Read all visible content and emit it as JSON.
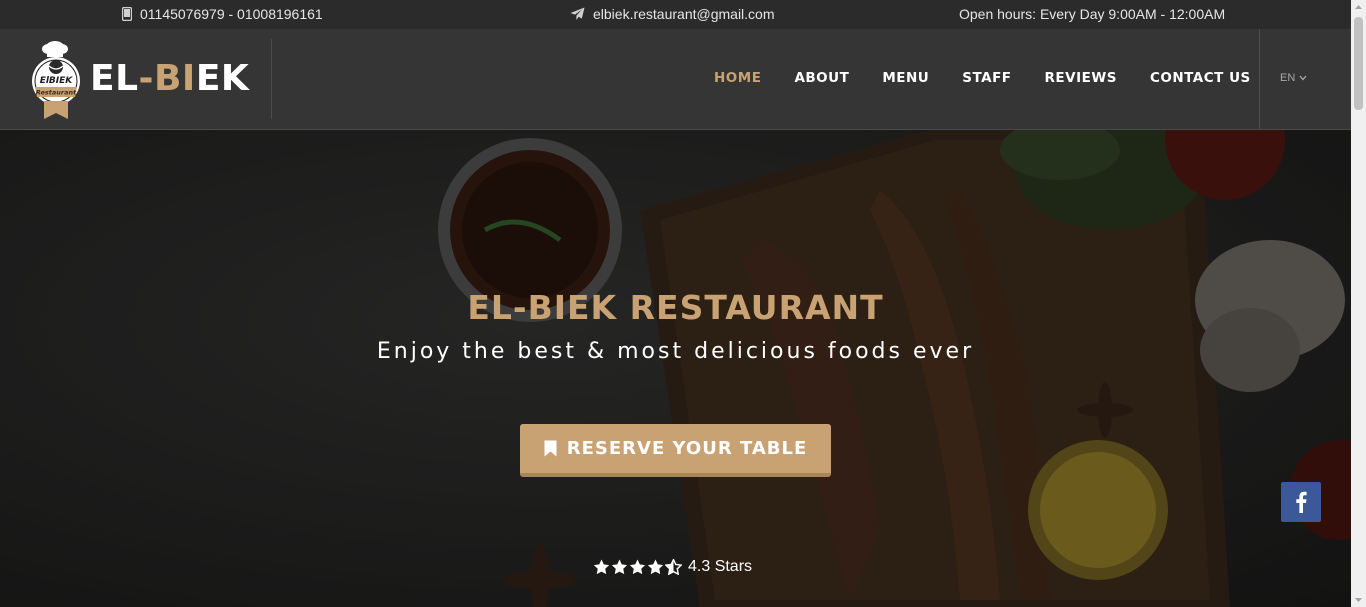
{
  "topbar": {
    "phone": "01145076979 - 01008196161",
    "email": "elbiek.restaurant@gmail.com",
    "hours": "Open hours: Every Day 9:00AM - 12:00AM",
    "phone_icon": "mobile-phone-icon",
    "email_icon": "paper-plane-icon"
  },
  "logo": {
    "badge_text_top": "ElBIEK",
    "badge_text_bottom": "Restaurant",
    "name_part1": "EL-BI",
    "name_part2": "EK"
  },
  "nav": {
    "items": [
      {
        "label": "HOME",
        "active": true
      },
      {
        "label": "ABOUT",
        "active": false
      },
      {
        "label": "MENU",
        "active": false
      },
      {
        "label": "STAFF",
        "active": false
      },
      {
        "label": "REVIEWS",
        "active": false
      },
      {
        "label": "CONTACT US",
        "active": false
      }
    ],
    "language": "EN"
  },
  "hero": {
    "title": "EL-BIEK RESTAURANT",
    "subtitle": "Enjoy the best & most delicious foods ever",
    "reserve_label": "RESERVE YOUR TABLE",
    "reserve_icon": "bookmark-icon",
    "rating_value": 4.3,
    "rating_max": 5,
    "rating_text": "4.3 Stars",
    "social": "facebook-icon"
  },
  "colors": {
    "accent": "#c9a273",
    "topbar_bg": "#2b2b2b",
    "header_bg": "#353535",
    "facebook": "#3b5998"
  }
}
